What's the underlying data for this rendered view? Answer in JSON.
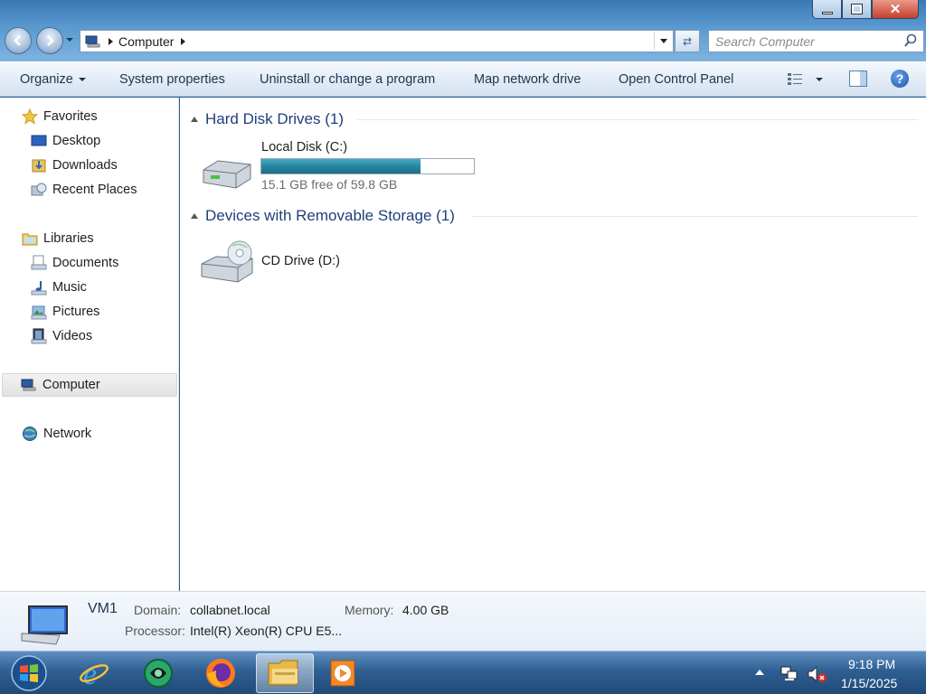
{
  "window": {
    "controls": [
      "minimize",
      "maximize",
      "close"
    ]
  },
  "address": {
    "crumbs": [
      "Computer"
    ]
  },
  "search": {
    "placeholder": "Search Computer"
  },
  "toolbar": {
    "organize": "Organize",
    "system_properties": "System properties",
    "uninstall": "Uninstall or change a program",
    "map_drive": "Map network drive",
    "control_panel": "Open Control Panel"
  },
  "sidebar": {
    "favorites": {
      "label": "Favorites",
      "items": [
        {
          "label": "Desktop"
        },
        {
          "label": "Downloads"
        },
        {
          "label": "Recent Places"
        }
      ]
    },
    "libraries": {
      "label": "Libraries",
      "items": [
        {
          "label": "Documents"
        },
        {
          "label": "Music"
        },
        {
          "label": "Pictures"
        },
        {
          "label": "Videos"
        }
      ]
    },
    "computer": {
      "label": "Computer"
    },
    "network": {
      "label": "Network"
    }
  },
  "content": {
    "hard_disks": {
      "header": "Hard Disk Drives (1)",
      "drives": [
        {
          "name": "Local Disk (C:)",
          "free_text": "15.1 GB free of 59.8 GB",
          "used_fraction": 0.75
        }
      ]
    },
    "removable": {
      "header": "Devices with Removable Storage (1)",
      "drives": [
        {
          "name": "CD Drive (D:)"
        }
      ]
    }
  },
  "details": {
    "name": "VM1",
    "domain_label": "Domain:",
    "domain": "collabnet.local",
    "memory_label": "Memory:",
    "memory": "4.00 GB",
    "processor_label": "Processor:",
    "processor": "Intel(R) Xeon(R) CPU E5..."
  },
  "taskbar": {
    "apps": [
      "start",
      "internet-explorer",
      "app-green",
      "firefox",
      "windows-explorer",
      "media-player"
    ],
    "time": "9:18 PM",
    "date": "1/15/2025"
  },
  "colors": {
    "accent": "#1e3f7a",
    "bar_fill": "#27869f",
    "taskbar": "#2f5f92"
  }
}
